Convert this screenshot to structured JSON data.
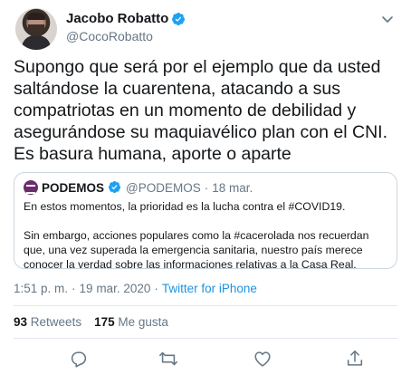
{
  "author": {
    "display_name": "Jacobo Robatto",
    "handle": "@CocoRobatto",
    "verified": true
  },
  "tweet": {
    "text": "Supongo que será por el ejemplo que da usted saltándose la cuarentena, atacando a sus compatriotas en un momento de debilidad y asegurándose su maquiavélico plan con el CNI. Es basura humana, aporte o aparte"
  },
  "quoted": {
    "display_name": "PODEMOS",
    "handle": "@PODEMOS",
    "separator": "·",
    "date": "18 mar.",
    "paragraphs": [
      "En estos momentos, la prioridad es la lucha contra el #COVID19.",
      "Sin embargo, acciones populares como la #cacerolada nos recuerdan que, una vez superada la emergencia sanitaria, nuestro país merece conocer la verdad sobre las informaciones relativas a la Casa Real."
    ]
  },
  "meta": {
    "time": "1:51 p. m.",
    "separator1": "·",
    "date": "19 mar. 2020",
    "separator2": "·",
    "source": "Twitter for iPhone"
  },
  "stats": {
    "retweets_count": "93",
    "retweets_label": "Retweets",
    "likes_count": "175",
    "likes_label": "Me gusta"
  },
  "colors": {
    "link": "#1b95e0",
    "muted": "#657786",
    "verified": "#1da1f2",
    "border": "#ccd6dd"
  },
  "icons": {
    "verified": "verified-badge-icon",
    "caret": "chevron-down-icon",
    "reply": "reply-icon",
    "retweet": "retweet-icon",
    "like": "heart-icon",
    "share": "share-icon"
  }
}
